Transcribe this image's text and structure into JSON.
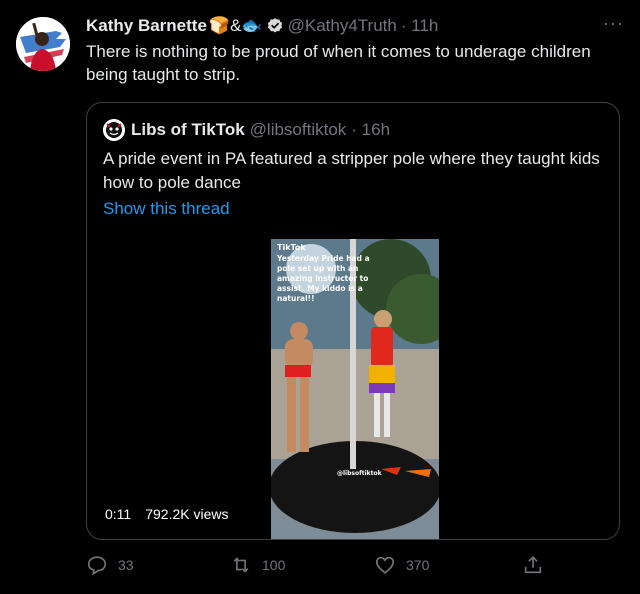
{
  "tweet": {
    "display_name": "Kathy Barnette",
    "name_emoji": "🍞&🐟",
    "handle": "@Kathy4Truth",
    "time": "· 11h",
    "more": "···",
    "text": "There is nothing to be proud of when it comes to underage children being taught to strip."
  },
  "quote": {
    "display_name": "Libs of TikTok",
    "handle": "@libsoftiktok",
    "time": "· 16h",
    "text": "A pride event in PA featured a stripper pole where they taught kids how to pole dance",
    "show_thread": "Show this thread",
    "video": {
      "duration": "0:11",
      "views": "792.2K views",
      "overlay_brand": "TikTok",
      "overlay_lines": [
        "Yesterday Pride had a",
        "pole set up with an",
        "amazing instructor to",
        "assist. My kiddo is a",
        "natural!!"
      ],
      "watermark": "@libsoftiktok"
    }
  },
  "actions": {
    "reply_count": "33",
    "retweet_count": "100",
    "like_count": "370"
  },
  "colors": {
    "accent": "#1d9bf0",
    "muted": "#71767b",
    "verified_badge": "#d9d9d9"
  },
  "icons": [
    "verified-icon",
    "more-icon",
    "reply-icon",
    "retweet-icon",
    "like-icon",
    "share-icon",
    "tiktok-icon"
  ]
}
